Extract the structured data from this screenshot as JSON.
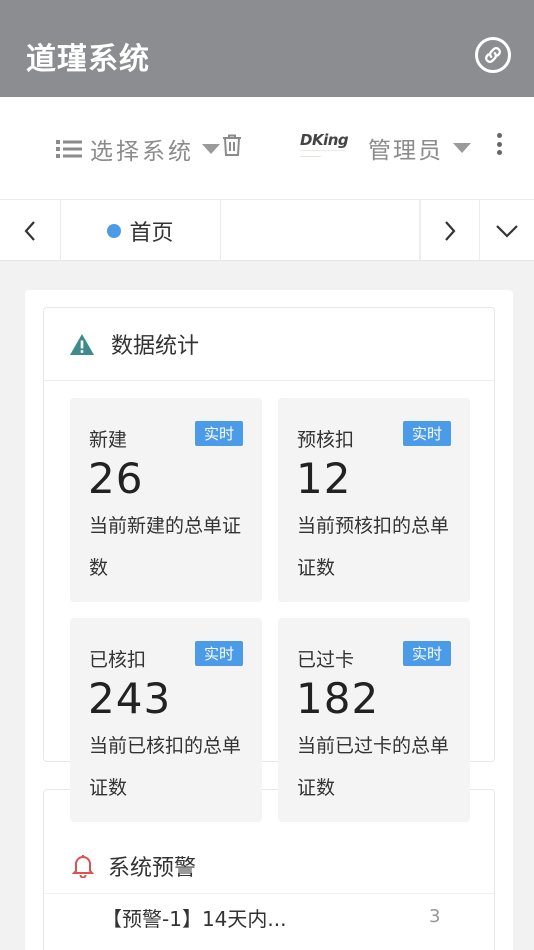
{
  "header": {
    "title": "道瑾系统",
    "link_icon": "link-icon"
  },
  "toolbar": {
    "system_select_label": "选择系统",
    "brand_logo_text": "DKing",
    "user_label": "管理员"
  },
  "tabs": {
    "home_label": "首页"
  },
  "stats": {
    "title": "数据统计",
    "tiles": [
      {
        "name": "新建",
        "badge": "实时",
        "value": "26",
        "desc": "当前新建的总单证数"
      },
      {
        "name": "预核扣",
        "badge": "实时",
        "value": "12",
        "desc": "当前预核扣的总单证数"
      },
      {
        "name": "已核扣",
        "badge": "实时",
        "value": "243",
        "desc": "当前已核扣的总单证数"
      },
      {
        "name": "已过卡",
        "badge": "实时",
        "value": "182",
        "desc": "当前已过卡的总单证数"
      }
    ]
  },
  "alerts": {
    "title": "系统预警",
    "items": [
      {
        "text": "【预警-1】14天内...",
        "count": "3"
      }
    ]
  },
  "colors": {
    "header_bg": "#8c8d91",
    "accent": "#4c9be8",
    "warning_icon": "#3d8c8a",
    "bell_icon": "#d9534f"
  }
}
